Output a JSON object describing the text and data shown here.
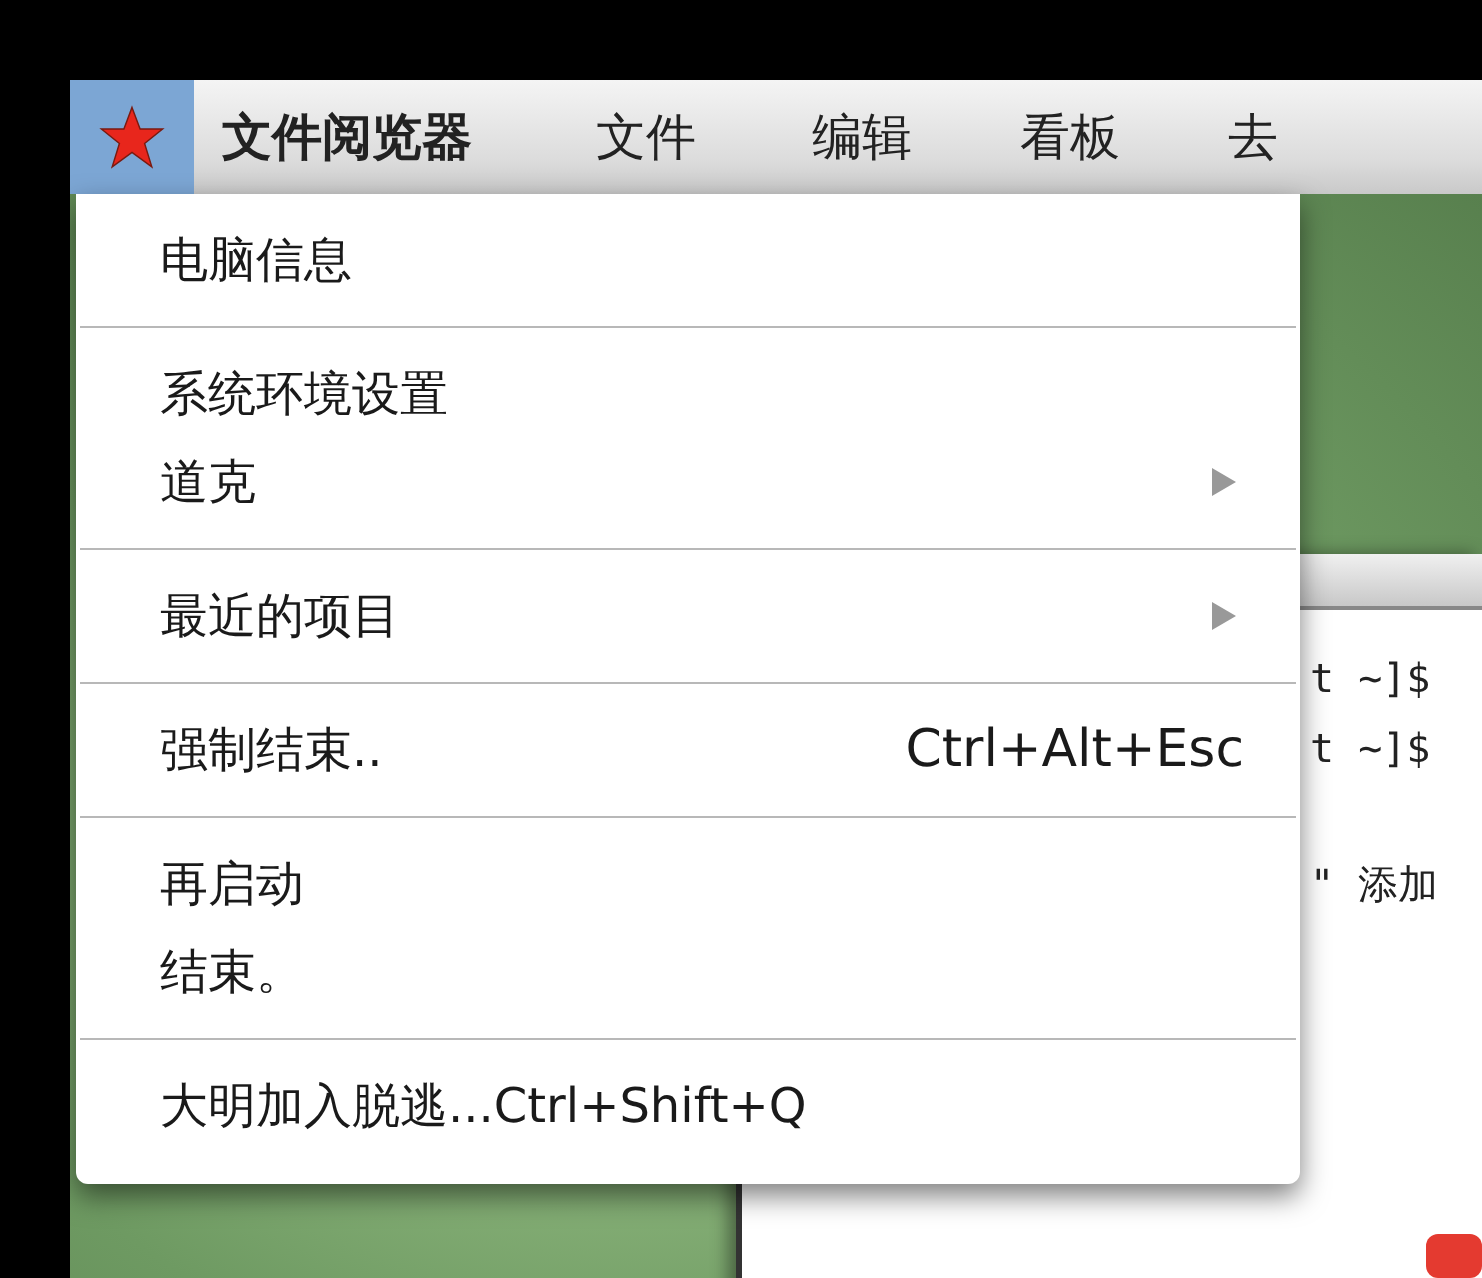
{
  "menubar": {
    "logo_selected": true,
    "items": [
      {
        "label": "文件阅览器",
        "kind": "app"
      },
      {
        "label": "文件",
        "kind": "menu"
      },
      {
        "label": "编辑",
        "kind": "menu"
      },
      {
        "label": "看板",
        "kind": "menu"
      },
      {
        "label": "去",
        "kind": "menu"
      }
    ]
  },
  "menu": {
    "sections": [
      [
        {
          "label": "电脑信息",
          "submenu": false
        }
      ],
      [
        {
          "label": "系统环境设置",
          "submenu": false
        },
        {
          "label": "道克",
          "submenu": true
        }
      ],
      [
        {
          "label": "最近的项目",
          "submenu": true
        }
      ],
      [
        {
          "label": "强制结束..",
          "shortcut": "Ctrl+Alt+Esc",
          "submenu": false
        }
      ],
      [
        {
          "label": "再启动",
          "submenu": false
        },
        {
          "label": "结束。",
          "submenu": false
        }
      ],
      [
        {
          "label": "大明加入脱逃...Ctrl+Shift+Q",
          "submenu": false
        }
      ]
    ]
  },
  "terminal": {
    "lines": [
      "t  ~]$",
      "t  ~]$",
      "\" 添加"
    ]
  }
}
